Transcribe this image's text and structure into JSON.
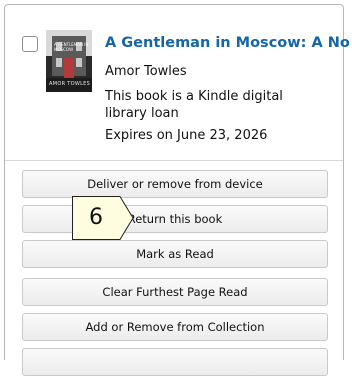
{
  "book": {
    "title": "A Gentleman in Moscow: A Novel",
    "author": "Amor Towles",
    "loan_text": "This book is a Kindle digital library loan",
    "expires": "Expires on June 23, 2026",
    "cover": {
      "title_text": "A GENTLEMAN IN MOSCOW",
      "author_text": "AMOR TOWLES"
    }
  },
  "actions": {
    "deliver_remove": "Deliver or remove from device",
    "return_book": "Return this book",
    "mark_read": "Mark as Read",
    "clear_page": "Clear Furthest Page Read",
    "add_remove_collection": "Add or Remove from Collection"
  },
  "annotation": {
    "step_number": "6"
  },
  "colors": {
    "title": "#1565a8",
    "callout_fill": "#fffde0"
  }
}
